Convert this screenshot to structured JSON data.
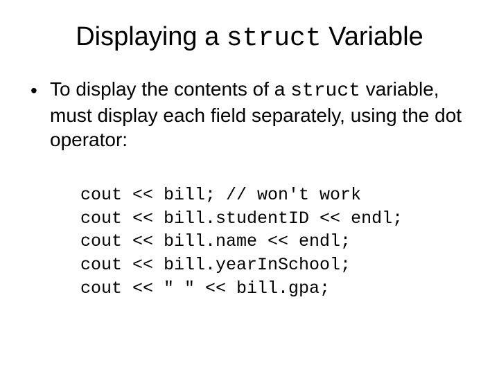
{
  "title": {
    "pre": "Displaying a ",
    "code": "struct",
    "post": " Variable"
  },
  "bullet": {
    "dot": "•",
    "part1": "To display the contents of a ",
    "code": "struct",
    "part2": " variable, must display each field separately, using the dot operator:"
  },
  "code_lines": [
    "cout << bill; // won't work",
    "cout << bill.studentID << endl;",
    "cout << bill.name << endl;",
    "cout << bill.yearInSchool;",
    "cout << \" \" << bill.gpa;"
  ]
}
